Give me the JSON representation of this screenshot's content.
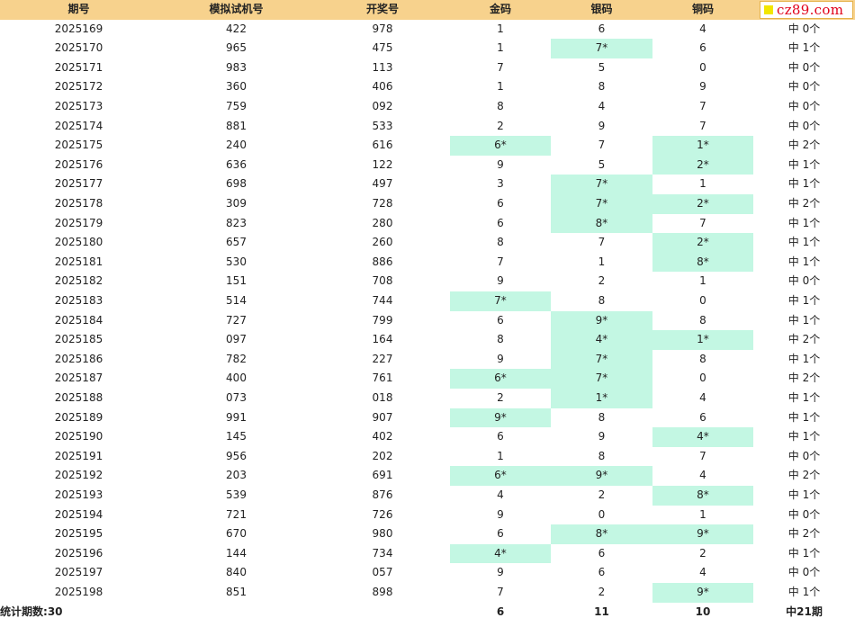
{
  "table": {
    "headers": [
      "期号",
      "模拟试机号",
      "开奖号",
      "金码",
      "银码",
      "铜码",
      ""
    ],
    "rows": [
      {
        "issue": "2025169",
        "sim": "422",
        "draw": "978",
        "gold": "1",
        "silver": "6",
        "bronze": "4",
        "result": "中 0个",
        "hits": []
      },
      {
        "issue": "2025170",
        "sim": "965",
        "draw": "475",
        "gold": "1",
        "silver": "7*",
        "bronze": "6",
        "result": "中 1个",
        "hits": [
          "silver"
        ]
      },
      {
        "issue": "2025171",
        "sim": "983",
        "draw": "113",
        "gold": "7",
        "silver": "5",
        "bronze": "0",
        "result": "中 0个",
        "hits": []
      },
      {
        "issue": "2025172",
        "sim": "360",
        "draw": "406",
        "gold": "1",
        "silver": "8",
        "bronze": "9",
        "result": "中 0个",
        "hits": []
      },
      {
        "issue": "2025173",
        "sim": "759",
        "draw": "092",
        "gold": "8",
        "silver": "4",
        "bronze": "7",
        "result": "中 0个",
        "hits": []
      },
      {
        "issue": "2025174",
        "sim": "881",
        "draw": "533",
        "gold": "2",
        "silver": "9",
        "bronze": "7",
        "result": "中 0个",
        "hits": []
      },
      {
        "issue": "2025175",
        "sim": "240",
        "draw": "616",
        "gold": "6*",
        "silver": "7",
        "bronze": "1*",
        "result": "中 2个",
        "hits": [
          "gold",
          "bronze"
        ]
      },
      {
        "issue": "2025176",
        "sim": "636",
        "draw": "122",
        "gold": "9",
        "silver": "5",
        "bronze": "2*",
        "result": "中 1个",
        "hits": [
          "bronze"
        ]
      },
      {
        "issue": "2025177",
        "sim": "698",
        "draw": "497",
        "gold": "3",
        "silver": "7*",
        "bronze": "1",
        "result": "中 1个",
        "hits": [
          "silver"
        ]
      },
      {
        "issue": "2025178",
        "sim": "309",
        "draw": "728",
        "gold": "6",
        "silver": "7*",
        "bronze": "2*",
        "result": "中 2个",
        "hits": [
          "silver",
          "bronze"
        ]
      },
      {
        "issue": "2025179",
        "sim": "823",
        "draw": "280",
        "gold": "6",
        "silver": "8*",
        "bronze": "7",
        "result": "中 1个",
        "hits": [
          "silver"
        ]
      },
      {
        "issue": "2025180",
        "sim": "657",
        "draw": "260",
        "gold": "8",
        "silver": "7",
        "bronze": "2*",
        "result": "中 1个",
        "hits": [
          "bronze"
        ]
      },
      {
        "issue": "2025181",
        "sim": "530",
        "draw": "886",
        "gold": "7",
        "silver": "1",
        "bronze": "8*",
        "result": "中 1个",
        "hits": [
          "bronze"
        ]
      },
      {
        "issue": "2025182",
        "sim": "151",
        "draw": "708",
        "gold": "9",
        "silver": "2",
        "bronze": "1",
        "result": "中 0个",
        "hits": []
      },
      {
        "issue": "2025183",
        "sim": "514",
        "draw": "744",
        "gold": "7*",
        "silver": "8",
        "bronze": "0",
        "result": "中 1个",
        "hits": [
          "gold"
        ]
      },
      {
        "issue": "2025184",
        "sim": "727",
        "draw": "799",
        "gold": "6",
        "silver": "9*",
        "bronze": "8",
        "result": "中 1个",
        "hits": [
          "silver"
        ]
      },
      {
        "issue": "2025185",
        "sim": "097",
        "draw": "164",
        "gold": "8",
        "silver": "4*",
        "bronze": "1*",
        "result": "中 2个",
        "hits": [
          "silver",
          "bronze"
        ]
      },
      {
        "issue": "2025186",
        "sim": "782",
        "draw": "227",
        "gold": "9",
        "silver": "7*",
        "bronze": "8",
        "result": "中 1个",
        "hits": [
          "silver"
        ]
      },
      {
        "issue": "2025187",
        "sim": "400",
        "draw": "761",
        "gold": "6*",
        "silver": "7*",
        "bronze": "0",
        "result": "中 2个",
        "hits": [
          "gold",
          "silver"
        ]
      },
      {
        "issue": "2025188",
        "sim": "073",
        "draw": "018",
        "gold": "2",
        "silver": "1*",
        "bronze": "4",
        "result": "中 1个",
        "hits": [
          "silver"
        ]
      },
      {
        "issue": "2025189",
        "sim": "991",
        "draw": "907",
        "gold": "9*",
        "silver": "8",
        "bronze": "6",
        "result": "中 1个",
        "hits": [
          "gold"
        ]
      },
      {
        "issue": "2025190",
        "sim": "145",
        "draw": "402",
        "gold": "6",
        "silver": "9",
        "bronze": "4*",
        "result": "中 1个",
        "hits": [
          "bronze"
        ]
      },
      {
        "issue": "2025191",
        "sim": "956",
        "draw": "202",
        "gold": "1",
        "silver": "8",
        "bronze": "7",
        "result": "中 0个",
        "hits": []
      },
      {
        "issue": "2025192",
        "sim": "203",
        "draw": "691",
        "gold": "6*",
        "silver": "9*",
        "bronze": "4",
        "result": "中 2个",
        "hits": [
          "gold",
          "silver"
        ]
      },
      {
        "issue": "2025193",
        "sim": "539",
        "draw": "876",
        "gold": "4",
        "silver": "2",
        "bronze": "8*",
        "result": "中 1个",
        "hits": [
          "bronze"
        ]
      },
      {
        "issue": "2025194",
        "sim": "721",
        "draw": "726",
        "gold": "9",
        "silver": "0",
        "bronze": "1",
        "result": "中 0个",
        "hits": []
      },
      {
        "issue": "2025195",
        "sim": "670",
        "draw": "980",
        "gold": "6",
        "silver": "8*",
        "bronze": "9*",
        "result": "中 2个",
        "hits": [
          "silver",
          "bronze"
        ]
      },
      {
        "issue": "2025196",
        "sim": "144",
        "draw": "734",
        "gold": "4*",
        "silver": "6",
        "bronze": "2",
        "result": "中 1个",
        "hits": [
          "gold"
        ]
      },
      {
        "issue": "2025197",
        "sim": "840",
        "draw": "057",
        "gold": "9",
        "silver": "6",
        "bronze": "4",
        "result": "中 0个",
        "hits": []
      },
      {
        "issue": "2025198",
        "sim": "851",
        "draw": "898",
        "gold": "7",
        "silver": "2",
        "bronze": "9*",
        "result": "中 1个",
        "hits": [
          "bronze"
        ]
      }
    ],
    "footer": {
      "label": "统计期数:",
      "count": "30",
      "gold": "6",
      "silver": "11",
      "bronze": "10",
      "total": "中21期"
    }
  },
  "watermark": {
    "text": "cz89.com"
  },
  "colors": {
    "header_bg": "#f7d28d",
    "hit_bg": "#c3f7e3",
    "watermark_red": "#e0001a",
    "watermark_square": "#f2e600"
  }
}
